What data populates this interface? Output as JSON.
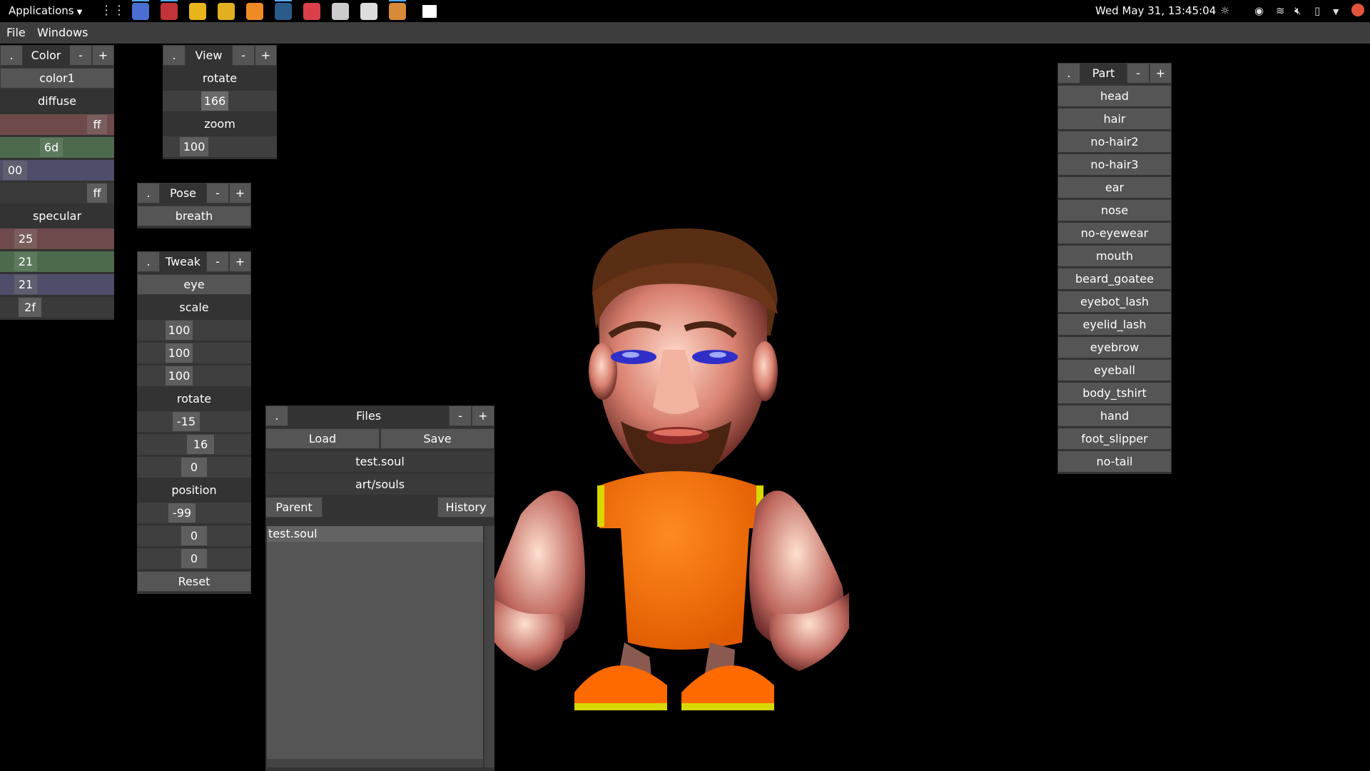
{
  "taskbar": {
    "applications_label": "Applications",
    "clock": "Wed May 31, 13:45:04",
    "launchers": [
      {
        "name": "files-icon",
        "color": "#4a6fd1"
      },
      {
        "name": "terminal-icon",
        "color": "#c0343a"
      },
      {
        "name": "chrome-icon",
        "color": "#e8b41c"
      },
      {
        "name": "cat-app-icon",
        "color": "#e0b020"
      },
      {
        "name": "blender-icon",
        "color": "#f08a24"
      },
      {
        "name": "steam-icon",
        "color": "#2a5b8a"
      },
      {
        "name": "game-app-icon",
        "color": "#d9404a"
      },
      {
        "name": "chat-app-icon",
        "color": "#cccccc"
      },
      {
        "name": "telegram-icon",
        "color": "#dddddd"
      },
      {
        "name": "bot-app-icon",
        "color": "#d68a3a"
      },
      {
        "name": "blank-window-icon",
        "color": "#ffffff"
      }
    ]
  },
  "menubar": {
    "file": "File",
    "windows": "Windows"
  },
  "color_panel": {
    "dot": ".",
    "title": "Color",
    "minus": "-",
    "plus": "+",
    "color_name": "color1",
    "diffuse_label": "diffuse",
    "diffuse_r": "ff",
    "diffuse_g": "6d",
    "diffuse_b": "00",
    "diffuse_a": "ff",
    "specular_label": "specular",
    "spec_r": "25",
    "spec_g": "21",
    "spec_b": "21",
    "spec_a": "2f"
  },
  "view_panel": {
    "dot": ".",
    "title": "View",
    "minus": "-",
    "plus": "+",
    "rotate_label": "rotate",
    "rotate_value": "166",
    "zoom_label": "zoom",
    "zoom_value": "100"
  },
  "pose_panel": {
    "dot": ".",
    "title": "Pose",
    "minus": "-",
    "plus": "+",
    "pose": "breath"
  },
  "tweak_panel": {
    "dot": ".",
    "title": "Tweak",
    "minus": "-",
    "plus": "+",
    "target": "eye",
    "scale_label": "scale",
    "scale_x": "100",
    "scale_y": "100",
    "scale_z": "100",
    "rotate_label": "rotate",
    "rot_x": "-15",
    "rot_y": "16",
    "rot_z": "0",
    "position_label": "position",
    "pos_x": "-99",
    "pos_y": "0",
    "pos_z": "0",
    "reset": "Reset"
  },
  "files_panel": {
    "dot": ".",
    "title": "Files",
    "minus": "-",
    "plus": "+",
    "load": "Load",
    "save": "Save",
    "filename": "test.soul",
    "folder": "art/souls",
    "parent": "Parent",
    "history": "History",
    "files": [
      "test.soul"
    ]
  },
  "part_panel": {
    "dot": ".",
    "title": "Part",
    "minus": "-",
    "plus": "+",
    "parts": [
      "head",
      "hair",
      "no-hair2",
      "no-hair3",
      "ear",
      "nose",
      "no-eyewear",
      "mouth",
      "beard_goatee",
      "eyebot_lash",
      "eyelid_lash",
      "eyebrow",
      "eyeball",
      "body_tshirt",
      "hand",
      "foot_slipper",
      "no-tail"
    ]
  },
  "colors": {
    "diffuse_r_bg": "#6e4a4a",
    "diffuse_g_bg": "#4e6a4e",
    "diffuse_b_bg": "#4e4e6a",
    "tshirt": "#ff7a10",
    "skin": "#e8a090",
    "hair": "#5a2e14",
    "trim": "#d8d800"
  }
}
